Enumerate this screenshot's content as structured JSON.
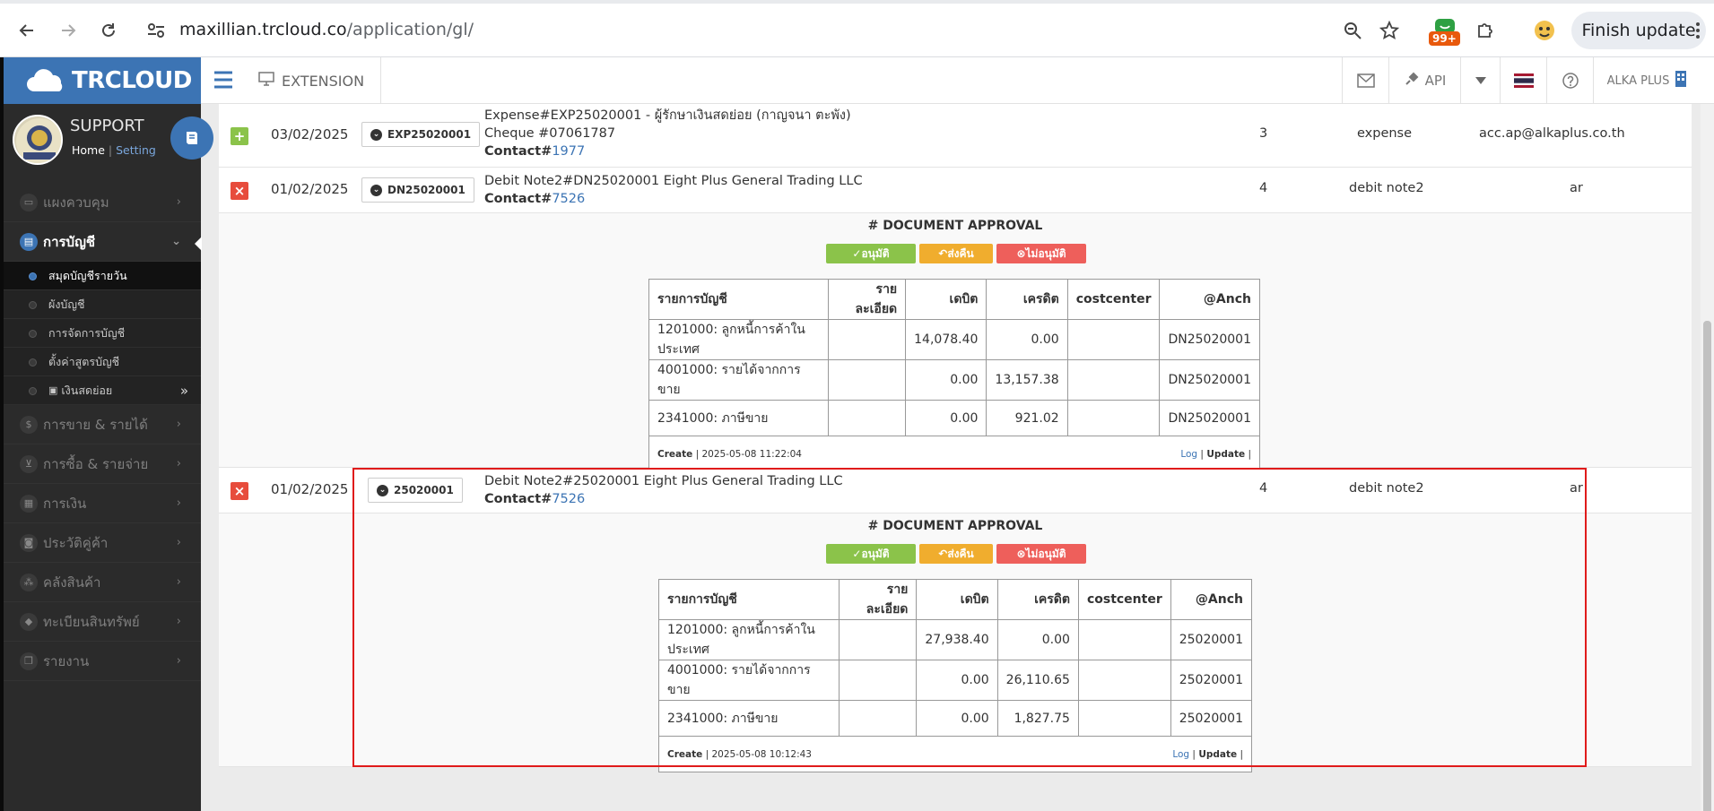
{
  "browser": {
    "url_host": "maxillian.trcloud.co",
    "url_path": "/application/gl/",
    "badge": "99+",
    "finish_update": "Finish update"
  },
  "header": {
    "logo": "TRCLOUD",
    "extension": "EXTENSION",
    "api": "API",
    "company": "ALKA PLUS"
  },
  "sidebar": {
    "user_name": "SUPPORT",
    "home": "Home",
    "setting": "Setting",
    "items": [
      {
        "label": "แผงควบคุม",
        "icon": "monitor-icon"
      },
      {
        "label": "การบัญชี",
        "icon": "book-icon",
        "active": true
      },
      {
        "label": "การขาย & รายได้",
        "icon": "dollar-icon"
      },
      {
        "label": "การซื้อ & รายจ่าย",
        "icon": "cart-icon"
      },
      {
        "label": "การเงิน",
        "icon": "calendar-icon"
      },
      {
        "label": "ประวัติคู่ค้า",
        "icon": "contact-icon"
      },
      {
        "label": "คลังสินค้า",
        "icon": "boxes-icon"
      },
      {
        "label": "ทะเบียนสินทรัพย์",
        "icon": "diamond-icon"
      },
      {
        "label": "รายงาน",
        "icon": "copy-icon"
      }
    ],
    "subitems": [
      {
        "label": "สมุดบัญชีรายวัน",
        "active": true
      },
      {
        "label": "ผังบัญชี"
      },
      {
        "label": "การจัดการบัญชี"
      },
      {
        "label": "ตั้งค่าสูตรบัญชี"
      },
      {
        "label": "เงินสดย่อย"
      }
    ]
  },
  "rows": [
    {
      "toggle": "+",
      "date": "03/02/2025",
      "doc": "EXP25020001",
      "desc_line1": "Expense#EXP25020001 - ผู้รักษาเงินสดย่อย (กาญจนา ตะพัง)",
      "desc_line2": "Cheque #07061787",
      "contact_label": "Contact#",
      "contact_num": "1977",
      "col_num": "3",
      "col_type": "expense",
      "col_extra": "acc.ap@alkaplus.co.th"
    },
    {
      "toggle": "×",
      "date": "01/02/2025",
      "doc": "DN25020001",
      "desc_line1": "Debit Note2#DN25020001 Eight Plus General Trading LLC",
      "contact_label": "Contact#",
      "contact_num": "7526",
      "col_num": "4",
      "col_type": "debit note2",
      "col_extra": "ar"
    },
    {
      "toggle": "×",
      "date": "01/02/2025",
      "doc": "25020001",
      "desc_line1": "Debit Note2#25020001 Eight Plus General Trading LLC",
      "contact_label": "Contact#",
      "contact_num": "7526",
      "col_num": "4",
      "col_type": "debit note2",
      "col_extra": "ar"
    }
  ],
  "approval": {
    "title": "# DOCUMENT APPROVAL",
    "approve": "อนุมัติ",
    "return": "ส่งคืน",
    "reject": "ไม่อนุมัติ"
  },
  "gl_headers": [
    "รายการบัญชี",
    "รายละเอียด",
    "เดบิต",
    "เครดิต",
    "costcenter",
    "@Anch"
  ],
  "gl1": {
    "rows": [
      [
        "1201000: ลูกหนี้การค้าในประเทศ",
        "",
        "14,078.40",
        "0.00",
        "",
        "DN25020001"
      ],
      [
        "4001000: รายได้จากการขาย",
        "",
        "0.00",
        "13,157.38",
        "",
        "DN25020001"
      ],
      [
        "2341000: ภาษีขาย",
        "",
        "0.00",
        "921.02",
        "",
        "DN25020001"
      ]
    ],
    "create": "Create",
    "created_at": "2025-05-08 11:22:04",
    "log": "Log",
    "update": "Update"
  },
  "gl2": {
    "rows": [
      [
        "1201000: ลูกหนี้การค้าในประเทศ",
        "",
        "27,938.40",
        "0.00",
        "",
        "25020001"
      ],
      [
        "4001000: รายได้จากการขาย",
        "",
        "0.00",
        "26,110.65",
        "",
        "25020001"
      ],
      [
        "2341000: ภาษีขาย",
        "",
        "0.00",
        "1,827.75",
        "",
        "25020001"
      ]
    ],
    "create": "Create",
    "created_at": "2025-05-08 10:12:43",
    "log": "Log",
    "update": "Update"
  }
}
